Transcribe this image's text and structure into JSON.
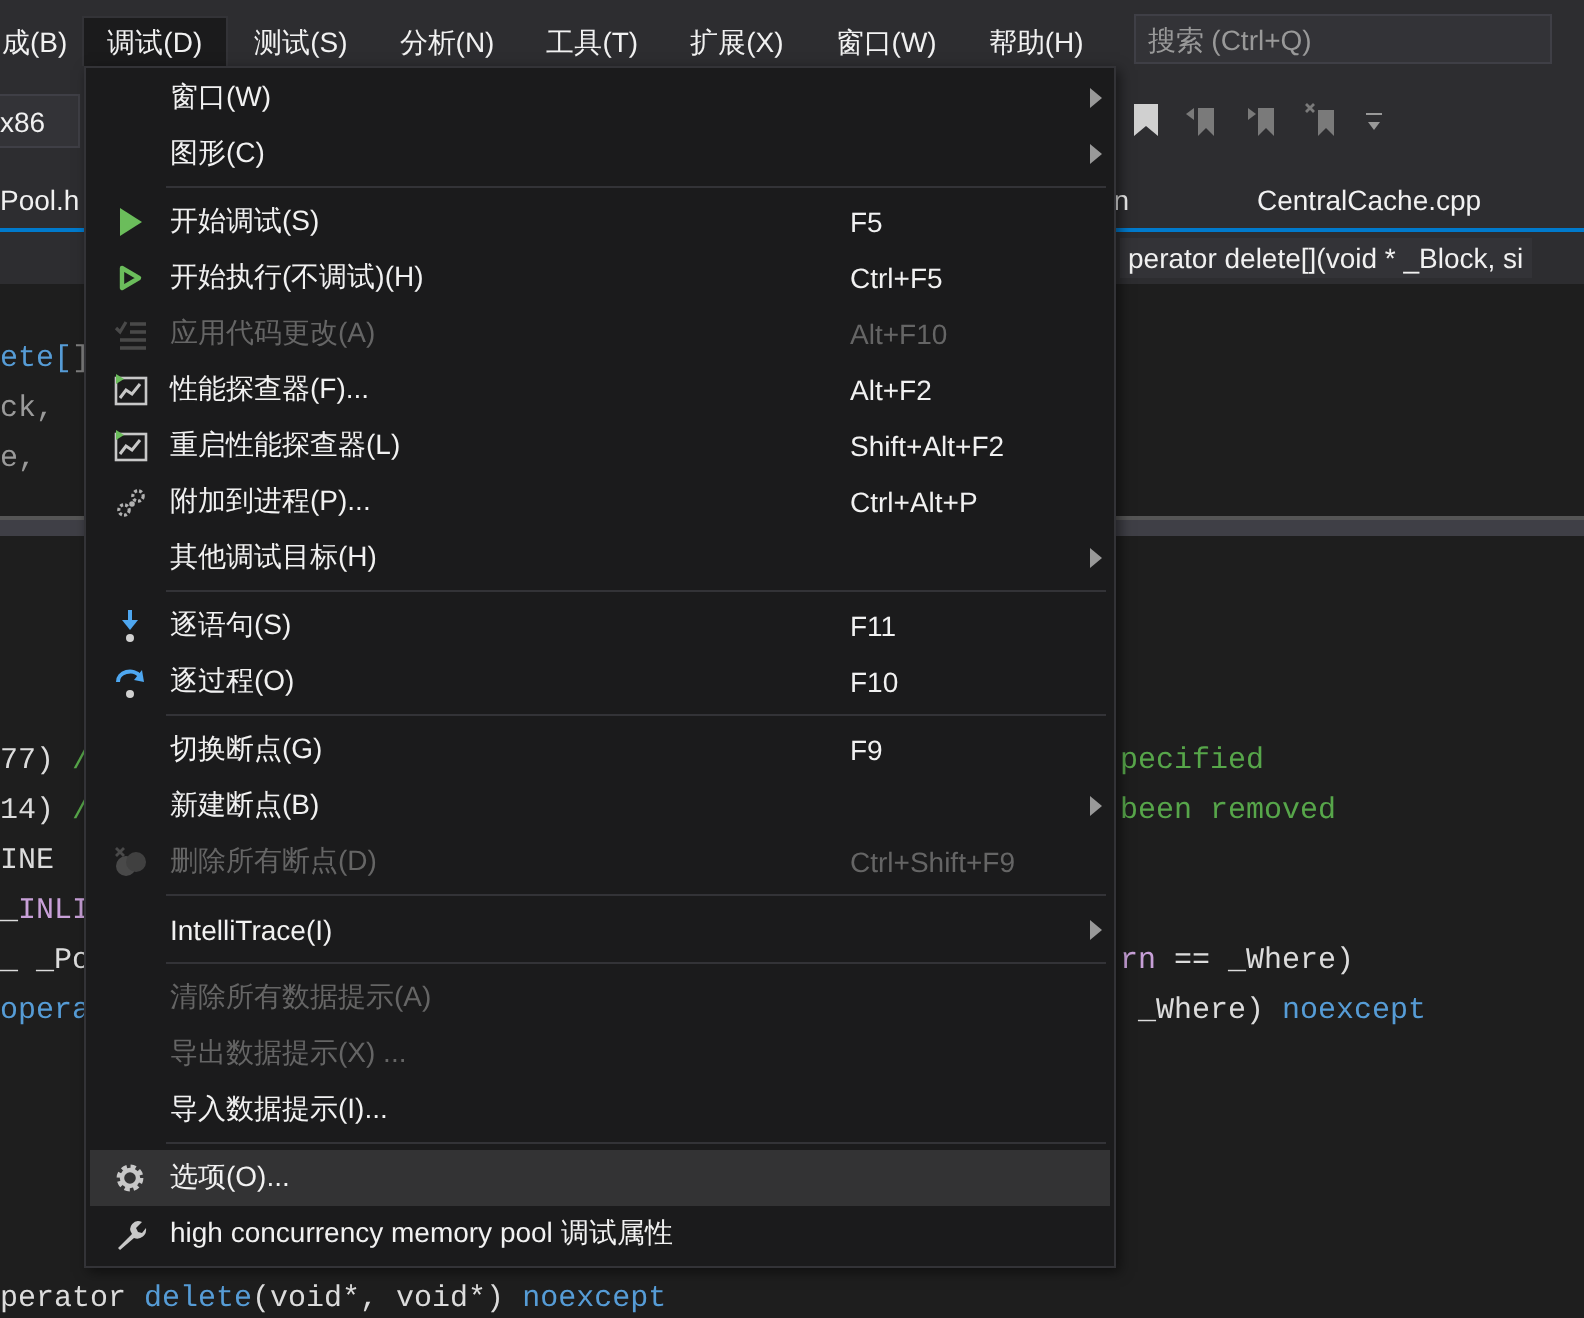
{
  "menu_bar": {
    "items": [
      {
        "label": "成(B)",
        "selected": false
      },
      {
        "label": "调试(D)",
        "selected": true
      },
      {
        "label": "测试(S)",
        "selected": false
      },
      {
        "label": "分析(N)",
        "selected": false
      },
      {
        "label": "工具(T)",
        "selected": false
      },
      {
        "label": "扩展(X)",
        "selected": false
      },
      {
        "label": "窗口(W)",
        "selected": false
      },
      {
        "label": "帮助(H)",
        "selected": false
      }
    ],
    "search": {
      "placeholder": "搜索 (Ctrl+Q)"
    }
  },
  "toolbar": {
    "platform": "x86"
  },
  "tabs": [
    {
      "label": "Pool.h",
      "selected": false
    },
    {
      "label": "n",
      "selected": false
    },
    {
      "label": "CentralCache.cpp",
      "selected": false
    }
  ],
  "navigation_bar": {
    "text": "perator delete[](void * _Block, si"
  },
  "editor": {
    "top_pane": [
      {
        "left": [
          {
            "text": "ete[",
            "kind": "keyword"
          },
          {
            "text": "]",
            "kind": "punct"
          }
        ]
      },
      {
        "left": [
          {
            "text": "ck,",
            "kind": "param"
          }
        ]
      },
      {
        "left": [
          {
            "text": "e,",
            "kind": "param"
          }
        ]
      }
    ],
    "bottom_pane": [
      {
        "left": [
          {
            "text": "77) ",
            "kind": "plain"
          },
          {
            "text": "/",
            "kind": "comment"
          }
        ],
        "right": [
          {
            "text": "pecified",
            "kind": "comment"
          }
        ]
      },
      {
        "left": [
          {
            "text": "14) ",
            "kind": "plain"
          },
          {
            "text": "/",
            "kind": "comment"
          }
        ],
        "right": [
          {
            "text": "been removed",
            "kind": "comment"
          }
        ]
      },
      {
        "left": [
          {
            "text": "INE",
            "kind": "plain"
          }
        ]
      },
      {
        "left": [
          {
            "text": "_",
            "kind": "plain"
          },
          {
            "text": "INLI",
            "kind": "macro"
          }
        ]
      },
      {
        "left": [
          {
            "text": "_ _Po",
            "kind": "plain"
          }
        ],
        "right": [
          {
            "text": "rn",
            "kind": "macro"
          },
          {
            "text": " == _Where)",
            "kind": "plain"
          }
        ]
      },
      {
        "left": [
          {
            "text": "opera",
            "kind": "keyword"
          }
        ],
        "right": [
          {
            "text": " _Where) ",
            "kind": "plain"
          },
          {
            "text": "noexcept",
            "kind": "keyword"
          }
        ]
      }
    ],
    "last_line": [
      {
        "text": "perator ",
        "kind": "plain"
      },
      {
        "text": "delete",
        "kind": "keyword"
      },
      {
        "text": "(void*, void*) ",
        "kind": "plain"
      },
      {
        "text": "noexcept",
        "kind": "keyword"
      }
    ]
  },
  "menu": {
    "items": [
      {
        "kind": "item",
        "label": "窗口(W)",
        "submenu": true,
        "disabled": false,
        "selected": false
      },
      {
        "kind": "item",
        "label": "图形(C)",
        "submenu": true,
        "disabled": false,
        "selected": false
      },
      {
        "kind": "separator"
      },
      {
        "kind": "item",
        "label": "开始调试(S)",
        "shortcut": "F5",
        "submenu": false,
        "disabled": false,
        "selected": false
      },
      {
        "kind": "item",
        "label": "开始执行(不调试)(H)",
        "shortcut": "Ctrl+F5",
        "submenu": false,
        "disabled": false,
        "selected": false
      },
      {
        "kind": "item",
        "label": "应用代码更改(A)",
        "shortcut": "Alt+F10",
        "submenu": false,
        "disabled": true,
        "selected": false
      },
      {
        "kind": "item",
        "label": "性能探查器(F)...",
        "shortcut": "Alt+F2",
        "submenu": false,
        "disabled": false,
        "selected": false
      },
      {
        "kind": "item",
        "label": "重启性能探查器(L)",
        "shortcut": "Shift+Alt+F2",
        "submenu": false,
        "disabled": false,
        "selected": false
      },
      {
        "kind": "item",
        "label": "附加到进程(P)...",
        "shortcut": "Ctrl+Alt+P",
        "submenu": false,
        "disabled": false,
        "selected": false
      },
      {
        "kind": "item",
        "label": "其他调试目标(H)",
        "submenu": true,
        "disabled": false,
        "selected": false
      },
      {
        "kind": "separator"
      },
      {
        "kind": "item",
        "label": "逐语句(S)",
        "shortcut": "F11",
        "submenu": false,
        "disabled": false,
        "selected": false
      },
      {
        "kind": "item",
        "label": "逐过程(O)",
        "shortcut": "F10",
        "submenu": false,
        "disabled": false,
        "selected": false
      },
      {
        "kind": "separator"
      },
      {
        "kind": "item",
        "label": "切换断点(G)",
        "shortcut": "F9",
        "submenu": false,
        "disabled": false,
        "selected": false
      },
      {
        "kind": "item",
        "label": "新建断点(B)",
        "submenu": true,
        "disabled": false,
        "selected": false
      },
      {
        "kind": "item",
        "label": "删除所有断点(D)",
        "shortcut": "Ctrl+Shift+F9",
        "submenu": false,
        "disabled": true,
        "selected": false
      },
      {
        "kind": "separator"
      },
      {
        "kind": "item",
        "label": "IntelliTrace(I)",
        "submenu": true,
        "disabled": false,
        "selected": false
      },
      {
        "kind": "separator"
      },
      {
        "kind": "item",
        "label": "清除所有数据提示(A)",
        "submenu": false,
        "disabled": true,
        "selected": false
      },
      {
        "kind": "item",
        "label": "导出数据提示(X) ...",
        "submenu": false,
        "disabled": true,
        "selected": false
      },
      {
        "kind": "item",
        "label": "导入数据提示(I)...",
        "submenu": false,
        "disabled": false,
        "selected": false
      },
      {
        "kind": "separator"
      },
      {
        "kind": "item",
        "label": "选项(O)...",
        "submenu": false,
        "disabled": false,
        "selected": true
      },
      {
        "kind": "item",
        "label": "high concurrency memory pool 调试属性",
        "submenu": false,
        "disabled": false,
        "selected": false
      }
    ]
  }
}
